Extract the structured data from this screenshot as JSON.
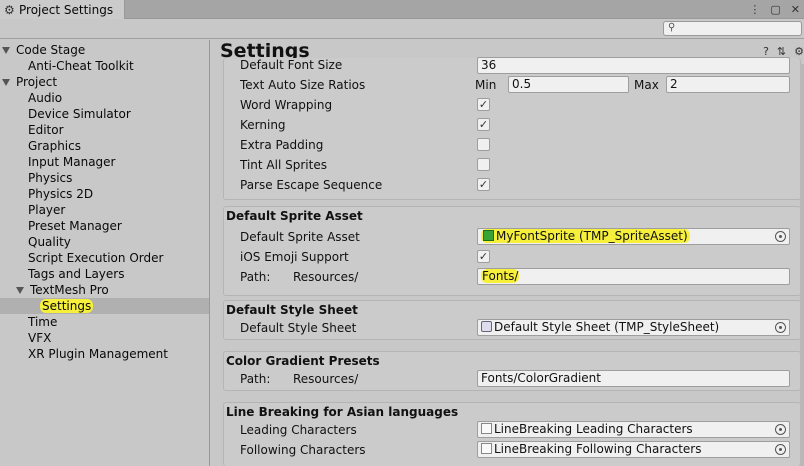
{
  "window": {
    "tab_title": "Project Settings",
    "menu_icon": "kebab-icon",
    "maximize_icon": "maximize-icon",
    "close_icon": "close-icon"
  },
  "search": {
    "placeholder": "",
    "icon": "search-icon"
  },
  "sidebar": {
    "items": [
      {
        "label": "Code Stage",
        "level": 0,
        "expanded": true
      },
      {
        "label": "Anti-Cheat Toolkit",
        "level": 1
      },
      {
        "label": "Project",
        "level": 0,
        "expanded": true
      },
      {
        "label": "Audio",
        "level": 1
      },
      {
        "label": "Device Simulator",
        "level": 1
      },
      {
        "label": "Editor",
        "level": 1
      },
      {
        "label": "Graphics",
        "level": 1
      },
      {
        "label": "Input Manager",
        "level": 1
      },
      {
        "label": "Physics",
        "level": 1
      },
      {
        "label": "Physics 2D",
        "level": 1
      },
      {
        "label": "Player",
        "level": 1
      },
      {
        "label": "Preset Manager",
        "level": 1
      },
      {
        "label": "Quality",
        "level": 1
      },
      {
        "label": "Script Execution Order",
        "level": 1
      },
      {
        "label": "Tags and Layers",
        "level": 1
      },
      {
        "label": "TextMesh Pro",
        "level": 1,
        "expanded": true
      },
      {
        "label": "Settings",
        "level": 2,
        "selected": true,
        "highlighted": true
      },
      {
        "label": "Time",
        "level": 1
      },
      {
        "label": "VFX",
        "level": 1
      },
      {
        "label": "XR Plugin Management",
        "level": 1
      }
    ]
  },
  "main": {
    "title": "Settings",
    "header_icons": [
      "help-icon",
      "preset-icon",
      "gear-icon"
    ],
    "settings_group": {
      "default_font_size_label": "Default Font Size",
      "default_font_size_value": "36",
      "auto_size_label": "Text Auto Size Ratios",
      "min_label": "Min",
      "min_value": "0.5",
      "max_label": "Max",
      "max_value": "2",
      "word_wrapping_label": "Word Wrapping",
      "word_wrapping": true,
      "kerning_label": "Kerning",
      "kerning": true,
      "extra_padding_label": "Extra Padding",
      "extra_padding": false,
      "tint_all_sprites_label": "Tint All Sprites",
      "tint_all_sprites": false,
      "parse_escape_label": "Parse Escape Sequence",
      "parse_escape": true
    },
    "sprite_group": {
      "title": "Default Sprite Asset",
      "asset_label": "Default Sprite Asset",
      "asset_value": "MyFontSprite (TMP_SpriteAsset)",
      "ios_emoji_label": "iOS Emoji Support",
      "ios_emoji": true,
      "path_label": "Path:",
      "path_prefix": "Resources/",
      "path_value": "Fonts/"
    },
    "style_group": {
      "title": "Default Style Sheet",
      "label": "Default Style Sheet",
      "value": "Default Style Sheet (TMP_StyleSheet)"
    },
    "gradient_group": {
      "title": "Color Gradient Presets",
      "path_label": "Path:",
      "path_prefix": "Resources/",
      "path_value": "Fonts/ColorGradient"
    },
    "linebreak_group": {
      "title": "Line Breaking for Asian languages",
      "leading_label": "Leading Characters",
      "leading_value": "LineBreaking Leading Characters",
      "following_label": "Following Characters",
      "following_value": "LineBreaking Following Characters"
    }
  },
  "colors": {
    "highlight": "#f6ef3c",
    "panel": "#c8c8c8",
    "field": "#f0f0f0",
    "selection": "#b0b0b0"
  }
}
